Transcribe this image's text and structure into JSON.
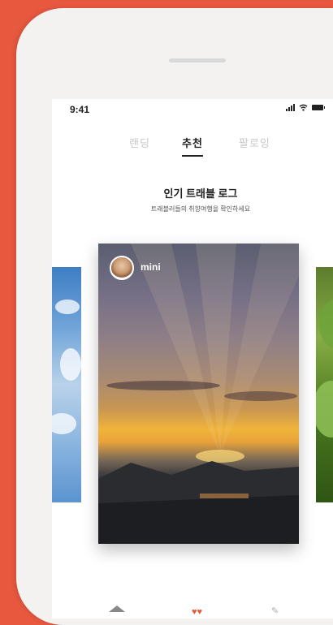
{
  "status_bar": {
    "time": "9:41"
  },
  "tabs": [
    {
      "label": "랜딩",
      "active": false
    },
    {
      "label": "추천",
      "active": true
    },
    {
      "label": "팔로잉",
      "active": false
    }
  ],
  "section": {
    "title": "인기 트래블 로그",
    "subtitle": "트래블러들의 취향여행을 확인하세요"
  },
  "main_card": {
    "username": "mini"
  },
  "colors": {
    "background": "#e8583f",
    "accent": "#e8583f"
  },
  "icons": [
    "signal-icon",
    "wifi-icon",
    "battery-icon",
    "home-icon",
    "heart-icon",
    "pen-icon"
  ]
}
